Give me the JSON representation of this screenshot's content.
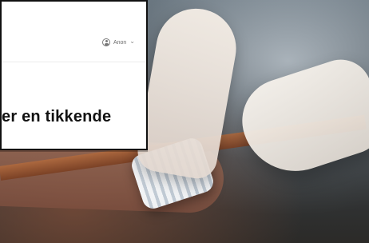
{
  "overlay": {
    "user_menu": {
      "label": "Anon",
      "chevron": "⌄",
      "icon": "user-icon"
    },
    "headline": "er en tikkende"
  },
  "colors": {
    "card_bg": "#ffffff",
    "card_border": "#111111",
    "headline_text": "#111111",
    "muted_text": "#6b6b6b"
  }
}
